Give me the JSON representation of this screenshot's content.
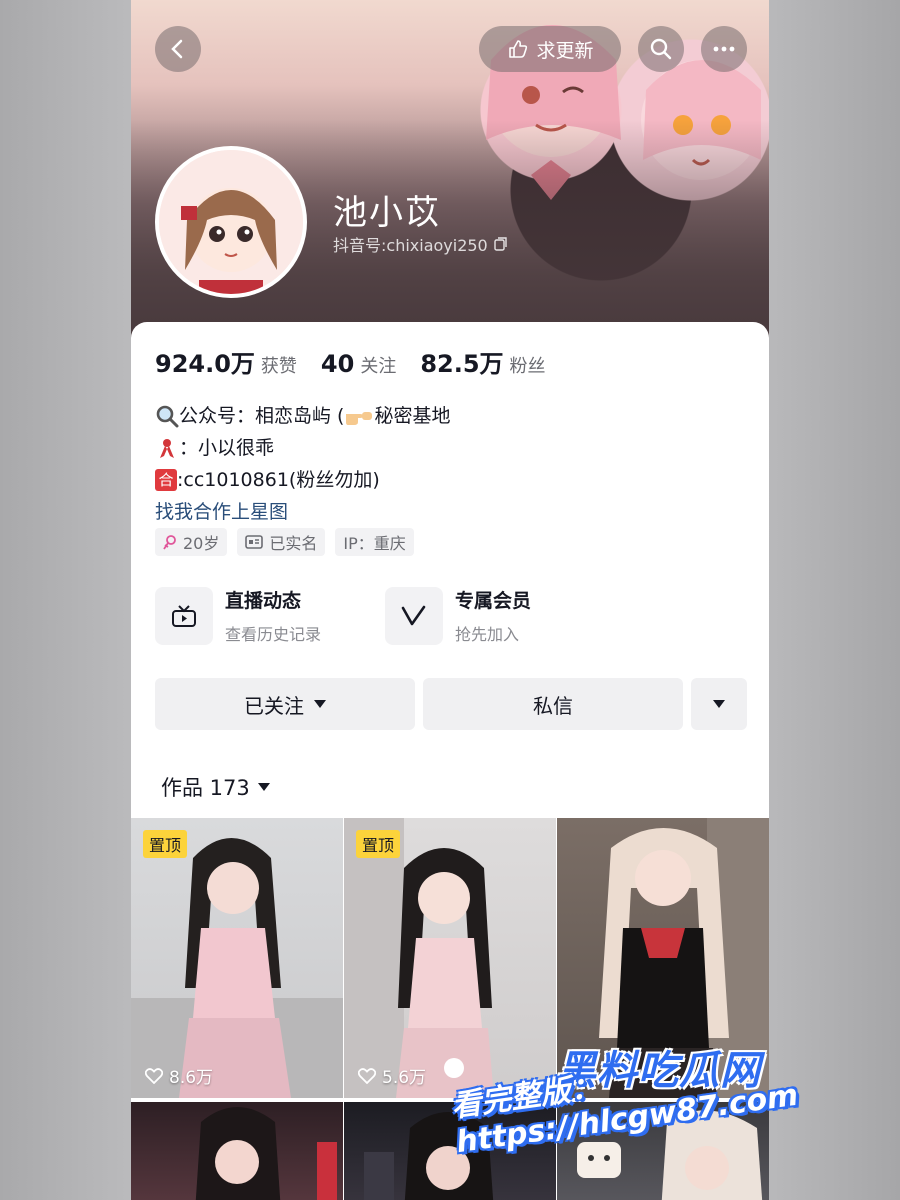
{
  "header": {
    "update_label": "求更新",
    "username": "池小苡",
    "douyin_id": "抖音号:chixiaoyi250"
  },
  "stats": [
    {
      "value": "924.0万",
      "label": "获赞"
    },
    {
      "value": "40",
      "label": "关注"
    },
    {
      "value": "82.5万",
      "label": "粉丝"
    }
  ],
  "bio": {
    "line1": "公众号：相恋岛屿 ( ",
    "line1_tail": "秘密基地",
    "line2": "：小以很乖",
    "line3_badge": "合",
    "line3": ":cc1010861(粉丝勿加)",
    "link": "找我合作上星图"
  },
  "tags": {
    "age": "20岁",
    "verified": "已实名",
    "ip": "IP：重庆"
  },
  "features": {
    "live_title": "直播动态",
    "live_sub": "查看历史记录",
    "member_title": "专属会员",
    "member_sub": "抢先加入"
  },
  "actions": {
    "follow": "已关注",
    "message": "私信"
  },
  "works": {
    "label": "作品 173"
  },
  "videos": [
    {
      "pinned": "置顶",
      "likes": "8.6万"
    },
    {
      "pinned": "置顶",
      "likes": "5.6万"
    },
    {
      "pinned": "",
      "likes": ""
    }
  ],
  "watermark": {
    "brand": "黑料吃瓜网",
    "url": "看完整版：https://hlcgw87.com"
  },
  "colors": {
    "accent_link": "#2a4e7a",
    "pin_badge": "#fcd33b",
    "watermark_blue": "#2f6df0"
  }
}
